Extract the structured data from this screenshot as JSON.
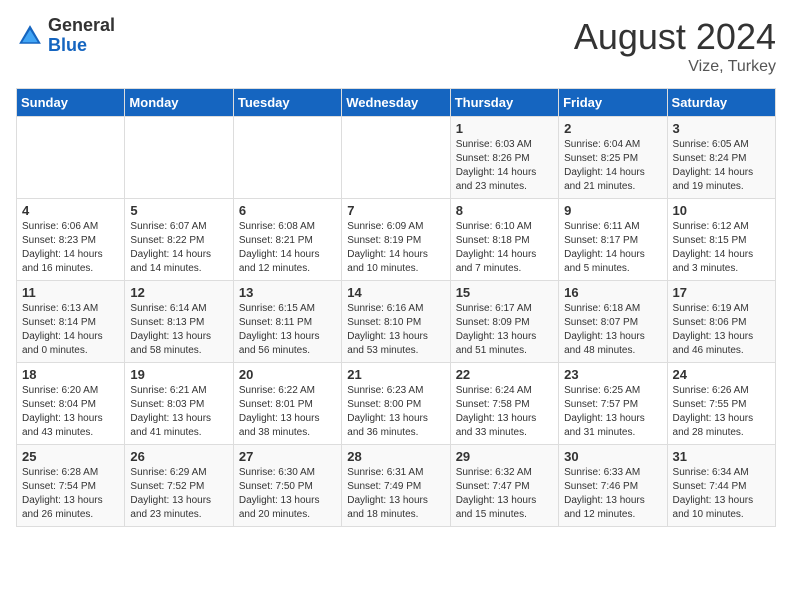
{
  "header": {
    "logo_general": "General",
    "logo_blue": "Blue",
    "month_title": "August 2024",
    "location": "Vize, Turkey"
  },
  "weekdays": [
    "Sunday",
    "Monday",
    "Tuesday",
    "Wednesday",
    "Thursday",
    "Friday",
    "Saturday"
  ],
  "weeks": [
    [
      {
        "day": "",
        "sunrise": "",
        "sunset": "",
        "daylight": ""
      },
      {
        "day": "",
        "sunrise": "",
        "sunset": "",
        "daylight": ""
      },
      {
        "day": "",
        "sunrise": "",
        "sunset": "",
        "daylight": ""
      },
      {
        "day": "",
        "sunrise": "",
        "sunset": "",
        "daylight": ""
      },
      {
        "day": "1",
        "sunrise": "Sunrise: 6:03 AM",
        "sunset": "Sunset: 8:26 PM",
        "daylight": "Daylight: 14 hours and 23 minutes."
      },
      {
        "day": "2",
        "sunrise": "Sunrise: 6:04 AM",
        "sunset": "Sunset: 8:25 PM",
        "daylight": "Daylight: 14 hours and 21 minutes."
      },
      {
        "day": "3",
        "sunrise": "Sunrise: 6:05 AM",
        "sunset": "Sunset: 8:24 PM",
        "daylight": "Daylight: 14 hours and 19 minutes."
      }
    ],
    [
      {
        "day": "4",
        "sunrise": "Sunrise: 6:06 AM",
        "sunset": "Sunset: 8:23 PM",
        "daylight": "Daylight: 14 hours and 16 minutes."
      },
      {
        "day": "5",
        "sunrise": "Sunrise: 6:07 AM",
        "sunset": "Sunset: 8:22 PM",
        "daylight": "Daylight: 14 hours and 14 minutes."
      },
      {
        "day": "6",
        "sunrise": "Sunrise: 6:08 AM",
        "sunset": "Sunset: 8:21 PM",
        "daylight": "Daylight: 14 hours and 12 minutes."
      },
      {
        "day": "7",
        "sunrise": "Sunrise: 6:09 AM",
        "sunset": "Sunset: 8:19 PM",
        "daylight": "Daylight: 14 hours and 10 minutes."
      },
      {
        "day": "8",
        "sunrise": "Sunrise: 6:10 AM",
        "sunset": "Sunset: 8:18 PM",
        "daylight": "Daylight: 14 hours and 7 minutes."
      },
      {
        "day": "9",
        "sunrise": "Sunrise: 6:11 AM",
        "sunset": "Sunset: 8:17 PM",
        "daylight": "Daylight: 14 hours and 5 minutes."
      },
      {
        "day": "10",
        "sunrise": "Sunrise: 6:12 AM",
        "sunset": "Sunset: 8:15 PM",
        "daylight": "Daylight: 14 hours and 3 minutes."
      }
    ],
    [
      {
        "day": "11",
        "sunrise": "Sunrise: 6:13 AM",
        "sunset": "Sunset: 8:14 PM",
        "daylight": "Daylight: 14 hours and 0 minutes."
      },
      {
        "day": "12",
        "sunrise": "Sunrise: 6:14 AM",
        "sunset": "Sunset: 8:13 PM",
        "daylight": "Daylight: 13 hours and 58 minutes."
      },
      {
        "day": "13",
        "sunrise": "Sunrise: 6:15 AM",
        "sunset": "Sunset: 8:11 PM",
        "daylight": "Daylight: 13 hours and 56 minutes."
      },
      {
        "day": "14",
        "sunrise": "Sunrise: 6:16 AM",
        "sunset": "Sunset: 8:10 PM",
        "daylight": "Daylight: 13 hours and 53 minutes."
      },
      {
        "day": "15",
        "sunrise": "Sunrise: 6:17 AM",
        "sunset": "Sunset: 8:09 PM",
        "daylight": "Daylight: 13 hours and 51 minutes."
      },
      {
        "day": "16",
        "sunrise": "Sunrise: 6:18 AM",
        "sunset": "Sunset: 8:07 PM",
        "daylight": "Daylight: 13 hours and 48 minutes."
      },
      {
        "day": "17",
        "sunrise": "Sunrise: 6:19 AM",
        "sunset": "Sunset: 8:06 PM",
        "daylight": "Daylight: 13 hours and 46 minutes."
      }
    ],
    [
      {
        "day": "18",
        "sunrise": "Sunrise: 6:20 AM",
        "sunset": "Sunset: 8:04 PM",
        "daylight": "Daylight: 13 hours and 43 minutes."
      },
      {
        "day": "19",
        "sunrise": "Sunrise: 6:21 AM",
        "sunset": "Sunset: 8:03 PM",
        "daylight": "Daylight: 13 hours and 41 minutes."
      },
      {
        "day": "20",
        "sunrise": "Sunrise: 6:22 AM",
        "sunset": "Sunset: 8:01 PM",
        "daylight": "Daylight: 13 hours and 38 minutes."
      },
      {
        "day": "21",
        "sunrise": "Sunrise: 6:23 AM",
        "sunset": "Sunset: 8:00 PM",
        "daylight": "Daylight: 13 hours and 36 minutes."
      },
      {
        "day": "22",
        "sunrise": "Sunrise: 6:24 AM",
        "sunset": "Sunset: 7:58 PM",
        "daylight": "Daylight: 13 hours and 33 minutes."
      },
      {
        "day": "23",
        "sunrise": "Sunrise: 6:25 AM",
        "sunset": "Sunset: 7:57 PM",
        "daylight": "Daylight: 13 hours and 31 minutes."
      },
      {
        "day": "24",
        "sunrise": "Sunrise: 6:26 AM",
        "sunset": "Sunset: 7:55 PM",
        "daylight": "Daylight: 13 hours and 28 minutes."
      }
    ],
    [
      {
        "day": "25",
        "sunrise": "Sunrise: 6:28 AM",
        "sunset": "Sunset: 7:54 PM",
        "daylight": "Daylight: 13 hours and 26 minutes."
      },
      {
        "day": "26",
        "sunrise": "Sunrise: 6:29 AM",
        "sunset": "Sunset: 7:52 PM",
        "daylight": "Daylight: 13 hours and 23 minutes."
      },
      {
        "day": "27",
        "sunrise": "Sunrise: 6:30 AM",
        "sunset": "Sunset: 7:50 PM",
        "daylight": "Daylight: 13 hours and 20 minutes."
      },
      {
        "day": "28",
        "sunrise": "Sunrise: 6:31 AM",
        "sunset": "Sunset: 7:49 PM",
        "daylight": "Daylight: 13 hours and 18 minutes."
      },
      {
        "day": "29",
        "sunrise": "Sunrise: 6:32 AM",
        "sunset": "Sunset: 7:47 PM",
        "daylight": "Daylight: 13 hours and 15 minutes."
      },
      {
        "day": "30",
        "sunrise": "Sunrise: 6:33 AM",
        "sunset": "Sunset: 7:46 PM",
        "daylight": "Daylight: 13 hours and 12 minutes."
      },
      {
        "day": "31",
        "sunrise": "Sunrise: 6:34 AM",
        "sunset": "Sunset: 7:44 PM",
        "daylight": "Daylight: 13 hours and 10 minutes."
      }
    ]
  ]
}
